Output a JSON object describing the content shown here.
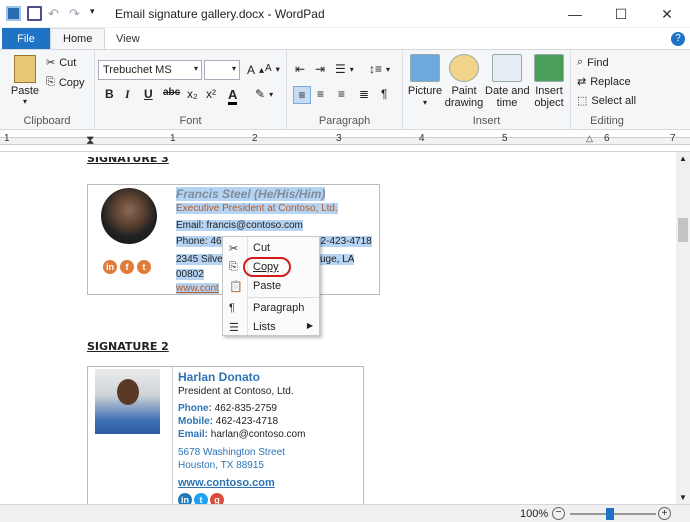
{
  "window": {
    "title": "Email signature gallery.docx - WordPad"
  },
  "tabs": {
    "file": "File",
    "home": "Home",
    "view": "View",
    "help": "?"
  },
  "clipboard": {
    "paste": "Paste",
    "cut": "Cut",
    "copy": "Copy",
    "label": "Clipboard"
  },
  "font": {
    "family": "Trebuchet MS",
    "size": "",
    "label": "Font",
    "bold": "B",
    "italic": "I",
    "underline": "U",
    "strike": "abc",
    "sub": "x₂",
    "sup": "x²",
    "color": "A"
  },
  "paragraph": {
    "label": "Paragraph"
  },
  "insert": {
    "picture": "Picture",
    "paint": "Paint\ndrawing",
    "datetime": "Date and\ntime",
    "object": "Insert\nobject",
    "label": "Insert"
  },
  "editing": {
    "find": "Find",
    "replace": "Replace",
    "selectall": "Select all",
    "label": "Editing"
  },
  "ruler": {
    "ticks": [
      "1",
      "1",
      "2",
      "3",
      "4",
      "5",
      "6",
      "7"
    ]
  },
  "sig1": {
    "heading": "SIGNATURE 3",
    "name": "Francis Steel (He/His/Him)",
    "title": "Executive President at Contoso, Ltd.",
    "email": "Email: francis@contoso.com",
    "phone_a": "Phone: 462",
    "phone_b": "62-423-4718",
    "addr_a": "2345 Silver",
    "addr_b": "uge, LA",
    "zip": "00802",
    "web": "www.cont"
  },
  "context_menu": {
    "cut": "Cut",
    "copy": "Copy",
    "paste": "Paste",
    "paragraph": "Paragraph",
    "lists": "Lists"
  },
  "sig2": {
    "heading": "SIGNATURE 2",
    "name": "Harlan Donato",
    "title": "President at Contoso, Ltd.",
    "phone_label": "Phone:",
    "phone": "462-835-2759",
    "mobile_label": "Mobile:",
    "mobile": "462-423-4718",
    "email_label": "Email:",
    "email": "harlan@contoso.com",
    "addr1": "5678 Washington Street",
    "addr2": "Houston, TX 88915",
    "web": "www.contoso.com"
  },
  "status": {
    "zoom": "100%"
  },
  "colors": {
    "accent": "#1e73c4",
    "selection": "#b5d3f3",
    "callout": "#d31b1b",
    "sig2_blue": "#2e74b5"
  }
}
